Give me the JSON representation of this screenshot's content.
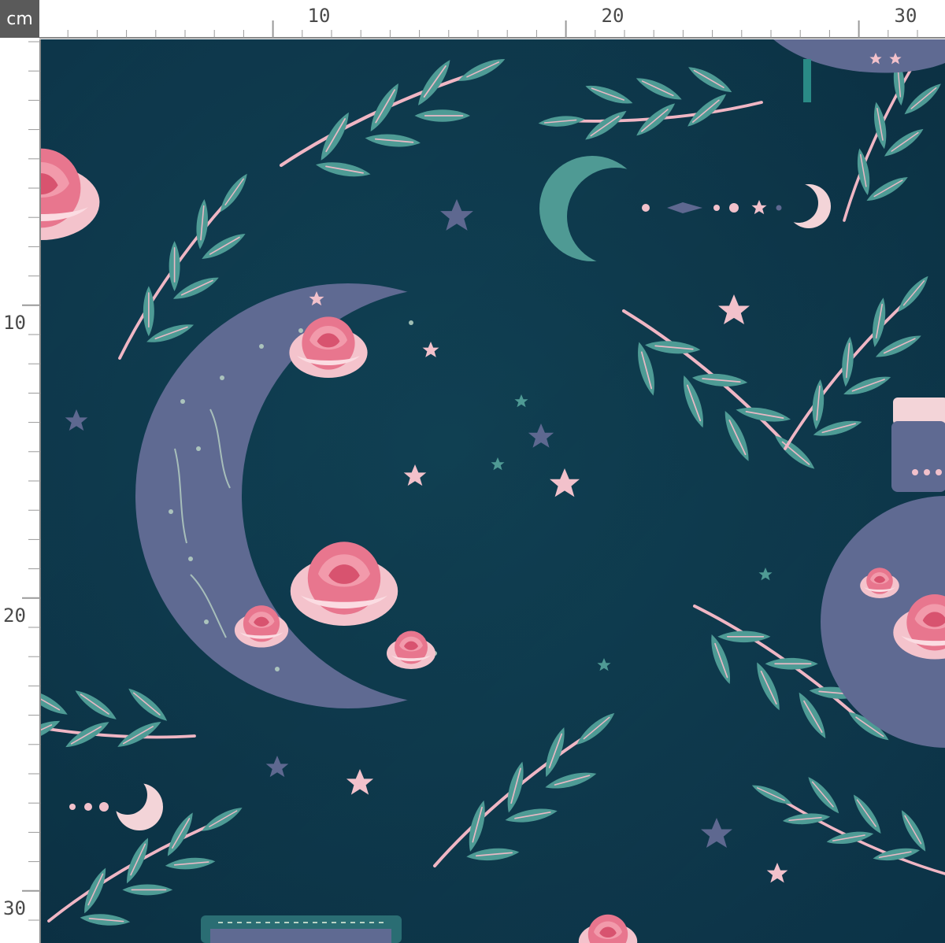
{
  "ruler": {
    "unit": "cm",
    "top_labels": [
      "10",
      "20",
      "30"
    ],
    "left_labels": [
      "10",
      "20",
      "30"
    ]
  },
  "colors": {
    "background": "#0f3a50",
    "moon": "#5f6a92",
    "small_moon": "#4f9a94",
    "leaf": "#4e9b95",
    "rose": "#e8768e",
    "rose_light": "#f4c3cc",
    "star_pink": "#f2c1cb",
    "star_muted": "#5e6890",
    "ruler_text": "#4a4a4a"
  },
  "pattern": {
    "motifs": [
      "crescent-moon",
      "rose",
      "leaf-sprig",
      "star",
      "potion-bottle",
      "moon-phase-row"
    ]
  }
}
